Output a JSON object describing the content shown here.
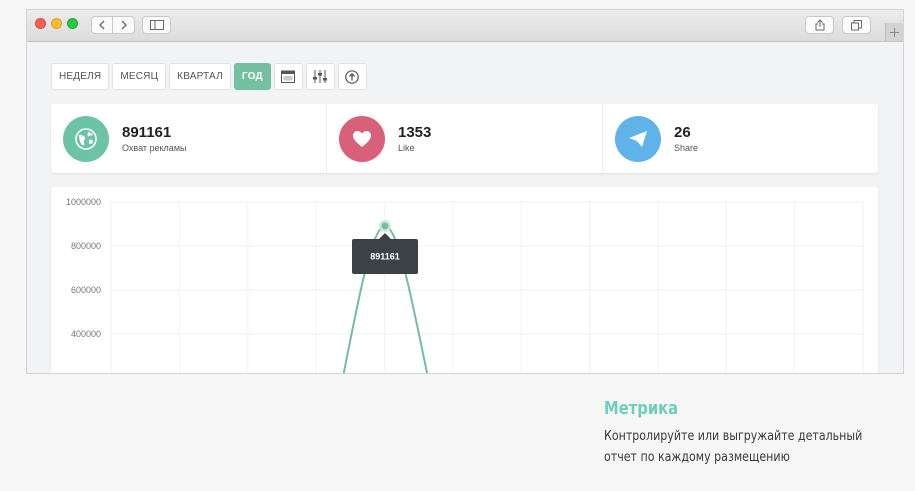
{
  "toolbar": {
    "tabs": [
      "НЕДЕЛЯ",
      "МЕСЯЦ",
      "КВАРТАЛ",
      "ГОД"
    ],
    "active_tab": "ГОД",
    "icon_buttons": [
      "calendar-icon",
      "sliders-icon",
      "upload-icon"
    ]
  },
  "stats": [
    {
      "value": "891161",
      "label": "Охват рекламы",
      "icon": "globe-icon",
      "color": "#6cc3a6"
    },
    {
      "value": "1353",
      "label": "Like",
      "icon": "heart-icon",
      "color": "#d9607a"
    },
    {
      "value": "26",
      "label": "Share",
      "icon": "paper-plane-icon",
      "color": "#5fb3e8"
    }
  ],
  "chart_data": {
    "type": "line",
    "y_ticks": [
      "1000000",
      "800000",
      "600000",
      "400000"
    ],
    "ylim": [
      0,
      1000000
    ],
    "peak_value": 891161,
    "tooltip": "891161",
    "line_color": "#74bda0",
    "grid": true
  },
  "caption": {
    "title": "Метрика",
    "line1": "Контролируйте или выгружайте детальный",
    "line2": "отчет по каждому размещению"
  },
  "colors": {
    "accent": "#74c0a1",
    "caption_title": "#6dcfb9"
  }
}
